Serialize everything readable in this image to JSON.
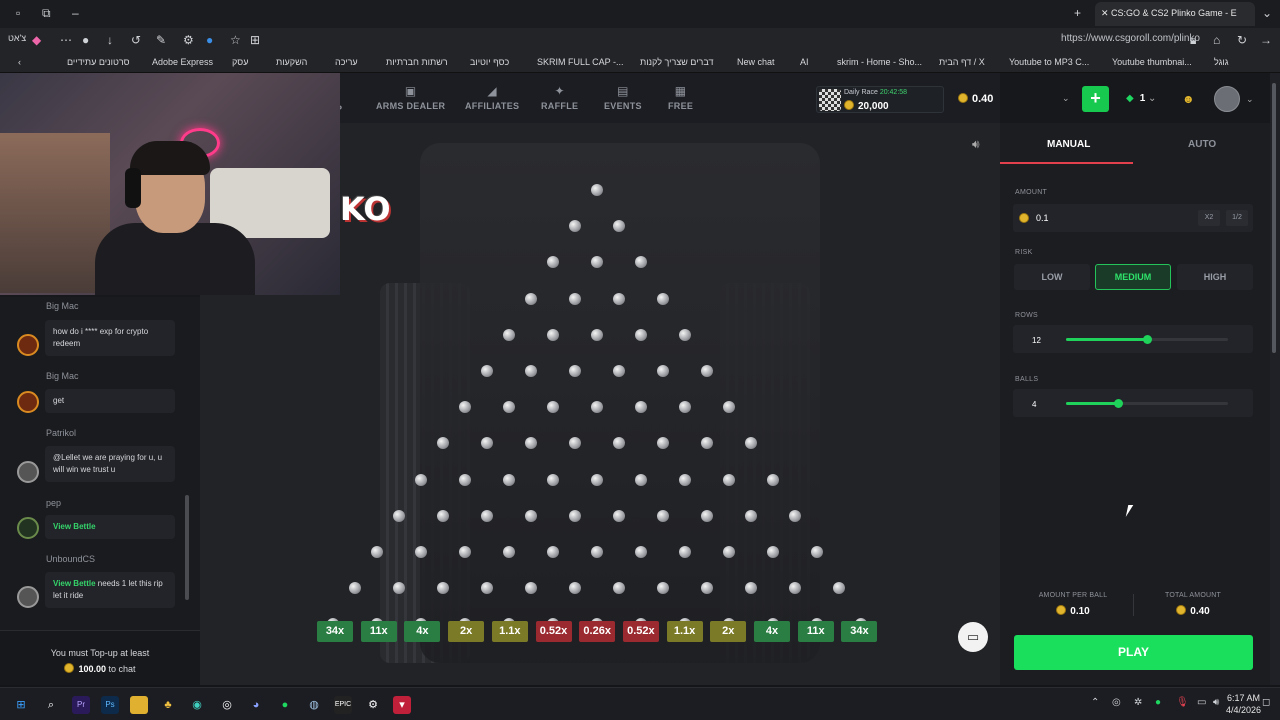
{
  "browser": {
    "tab_title": "CS:GO & CS2 Plinko Game - E",
    "url": "https://www.csgoroll.com/plinko",
    "profile_label": "צ'אט",
    "bookmarks": [
      "סרטונים עתידיים",
      "Adobe Express",
      "עסק",
      "השקעות",
      "עריכה",
      "רשתות חברתיות",
      "כסף יוטיוב",
      "SKRIM FULL CAP -...",
      "דברים שצריך לקנות",
      "New chat",
      "AI",
      "skrim - Home - Sho...",
      "דף הבית / X",
      "Youtube to MP3 C...",
      "Youtube thumbnai...",
      "גוגל"
    ]
  },
  "header": {
    "nav": [
      "ARMS DEALER",
      "AFFILIATES",
      "RAFFLE",
      "EVENTS",
      "FREE"
    ],
    "partial_nav": "P",
    "daily_race_label": "Daily Race",
    "daily_race_timer": "20:42:58",
    "daily_race_amount": "20,000",
    "balance": "0.40",
    "gem_count": "1"
  },
  "game": {
    "logo_text": "KO",
    "multipliers": [
      {
        "label": "34x",
        "color": "#2a7d43"
      },
      {
        "label": "11x",
        "color": "#2a7d43"
      },
      {
        "label": "4x",
        "color": "#2a7d43"
      },
      {
        "label": "2x",
        "color": "#7b7a26"
      },
      {
        "label": "1.1x",
        "color": "#7b7a26"
      },
      {
        "label": "0.52x",
        "color": "#9a2a30"
      },
      {
        "label": "0.26x",
        "color": "#9a2a30"
      },
      {
        "label": "0.52x",
        "color": "#9a2a30"
      },
      {
        "label": "1.1x",
        "color": "#7b7a26"
      },
      {
        "label": "2x",
        "color": "#7b7a26"
      },
      {
        "label": "4x",
        "color": "#2a7d43"
      },
      {
        "label": "11x",
        "color": "#2a7d43"
      },
      {
        "label": "34x",
        "color": "#2a7d43"
      }
    ],
    "rows": 12
  },
  "panel": {
    "tab_manual": "MANUAL",
    "tab_auto": "AUTO",
    "amount_label": "AMOUNT",
    "amount_value": "0.1",
    "x2": "X2",
    "half": "1/2",
    "risk_label": "RISK",
    "risk_options": [
      "LOW",
      "MEDIUM",
      "HIGH"
    ],
    "risk_selected": "MEDIUM",
    "rows_label": "ROWS",
    "rows_value": "12",
    "rows_level": 0.5,
    "balls_label": "BALLS",
    "balls_value": "4",
    "balls_level": 0.32,
    "amount_per_ball_label": "AMOUNT PER BALL",
    "amount_per_ball": "0.10",
    "total_amount_label": "TOTAL AMOUNT",
    "total_amount": "0.40",
    "play_label": "PLAY"
  },
  "chat": {
    "messages": [
      {
        "user": "Big Mac",
        "text": "how do i **** exp for crypto redeem"
      },
      {
        "user": "Big Mac",
        "text": "get"
      },
      {
        "user": "Patrikol",
        "text": "@Lellet we are praying for u, u will win we trust u"
      },
      {
        "user": "pep",
        "text": "View Bettle"
      },
      {
        "user": "UnboundCS",
        "link": "View Bettle",
        "text": " needs 1 let this rip let it ride"
      }
    ],
    "footer_line1": "You must Top-up at least",
    "footer_amount": "100.00",
    "footer_line2": "to chat"
  },
  "taskbar": {
    "time": "6:17 AM",
    "date": "4/4/2026"
  }
}
